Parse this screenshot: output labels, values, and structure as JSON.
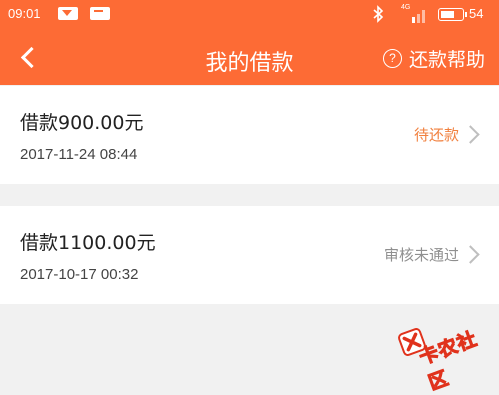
{
  "status_bar": {
    "time": "09:01",
    "network": "4G",
    "battery": "54"
  },
  "nav": {
    "title": "我的借款",
    "help_icon_glyph": "?",
    "help_label": "还款帮助"
  },
  "loans": [
    {
      "amount": "借款900.00元",
      "date": "2017-11-24 08:44",
      "status": "待还款",
      "status_color": "#f1813f"
    },
    {
      "amount": "借款1100.00元",
      "date": "2017-10-17 00:32",
      "status": "审核未通过",
      "status_color": "#8f8f8f"
    }
  ],
  "watermark": {
    "text": "卡农社区"
  },
  "colors": {
    "accent": "#fd6b35",
    "background": "#f1f1f1"
  }
}
